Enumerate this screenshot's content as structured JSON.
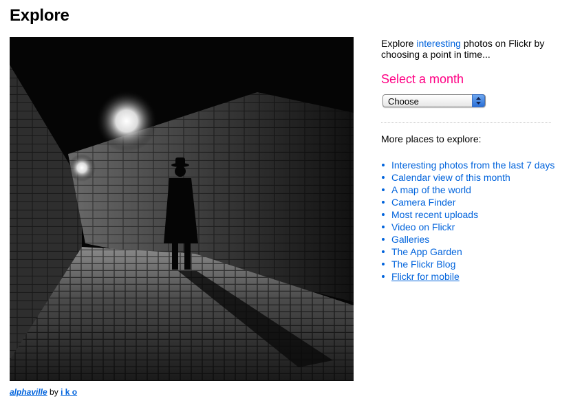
{
  "page": {
    "title": "Explore"
  },
  "photo": {
    "title": "alphaville",
    "by_label": "by",
    "author": "i k o"
  },
  "sidebar": {
    "intro_before": "Explore",
    "intro_link": "interesting",
    "intro_after": "photos on Flickr by choosing a point in time...",
    "select_heading": "Select a month",
    "select_value": "Choose",
    "more_heading": "More places to explore:",
    "links": [
      "Interesting photos from the last 7 days",
      "Calendar view of this month",
      "A map of the world",
      "Camera Finder",
      "Most recent uploads",
      "Video on Flickr",
      "Galleries",
      "The App Garden",
      "The Flickr Blog",
      "Flickr for mobile"
    ]
  },
  "colors": {
    "link": "#0063dc",
    "accent": "#ff0084"
  }
}
